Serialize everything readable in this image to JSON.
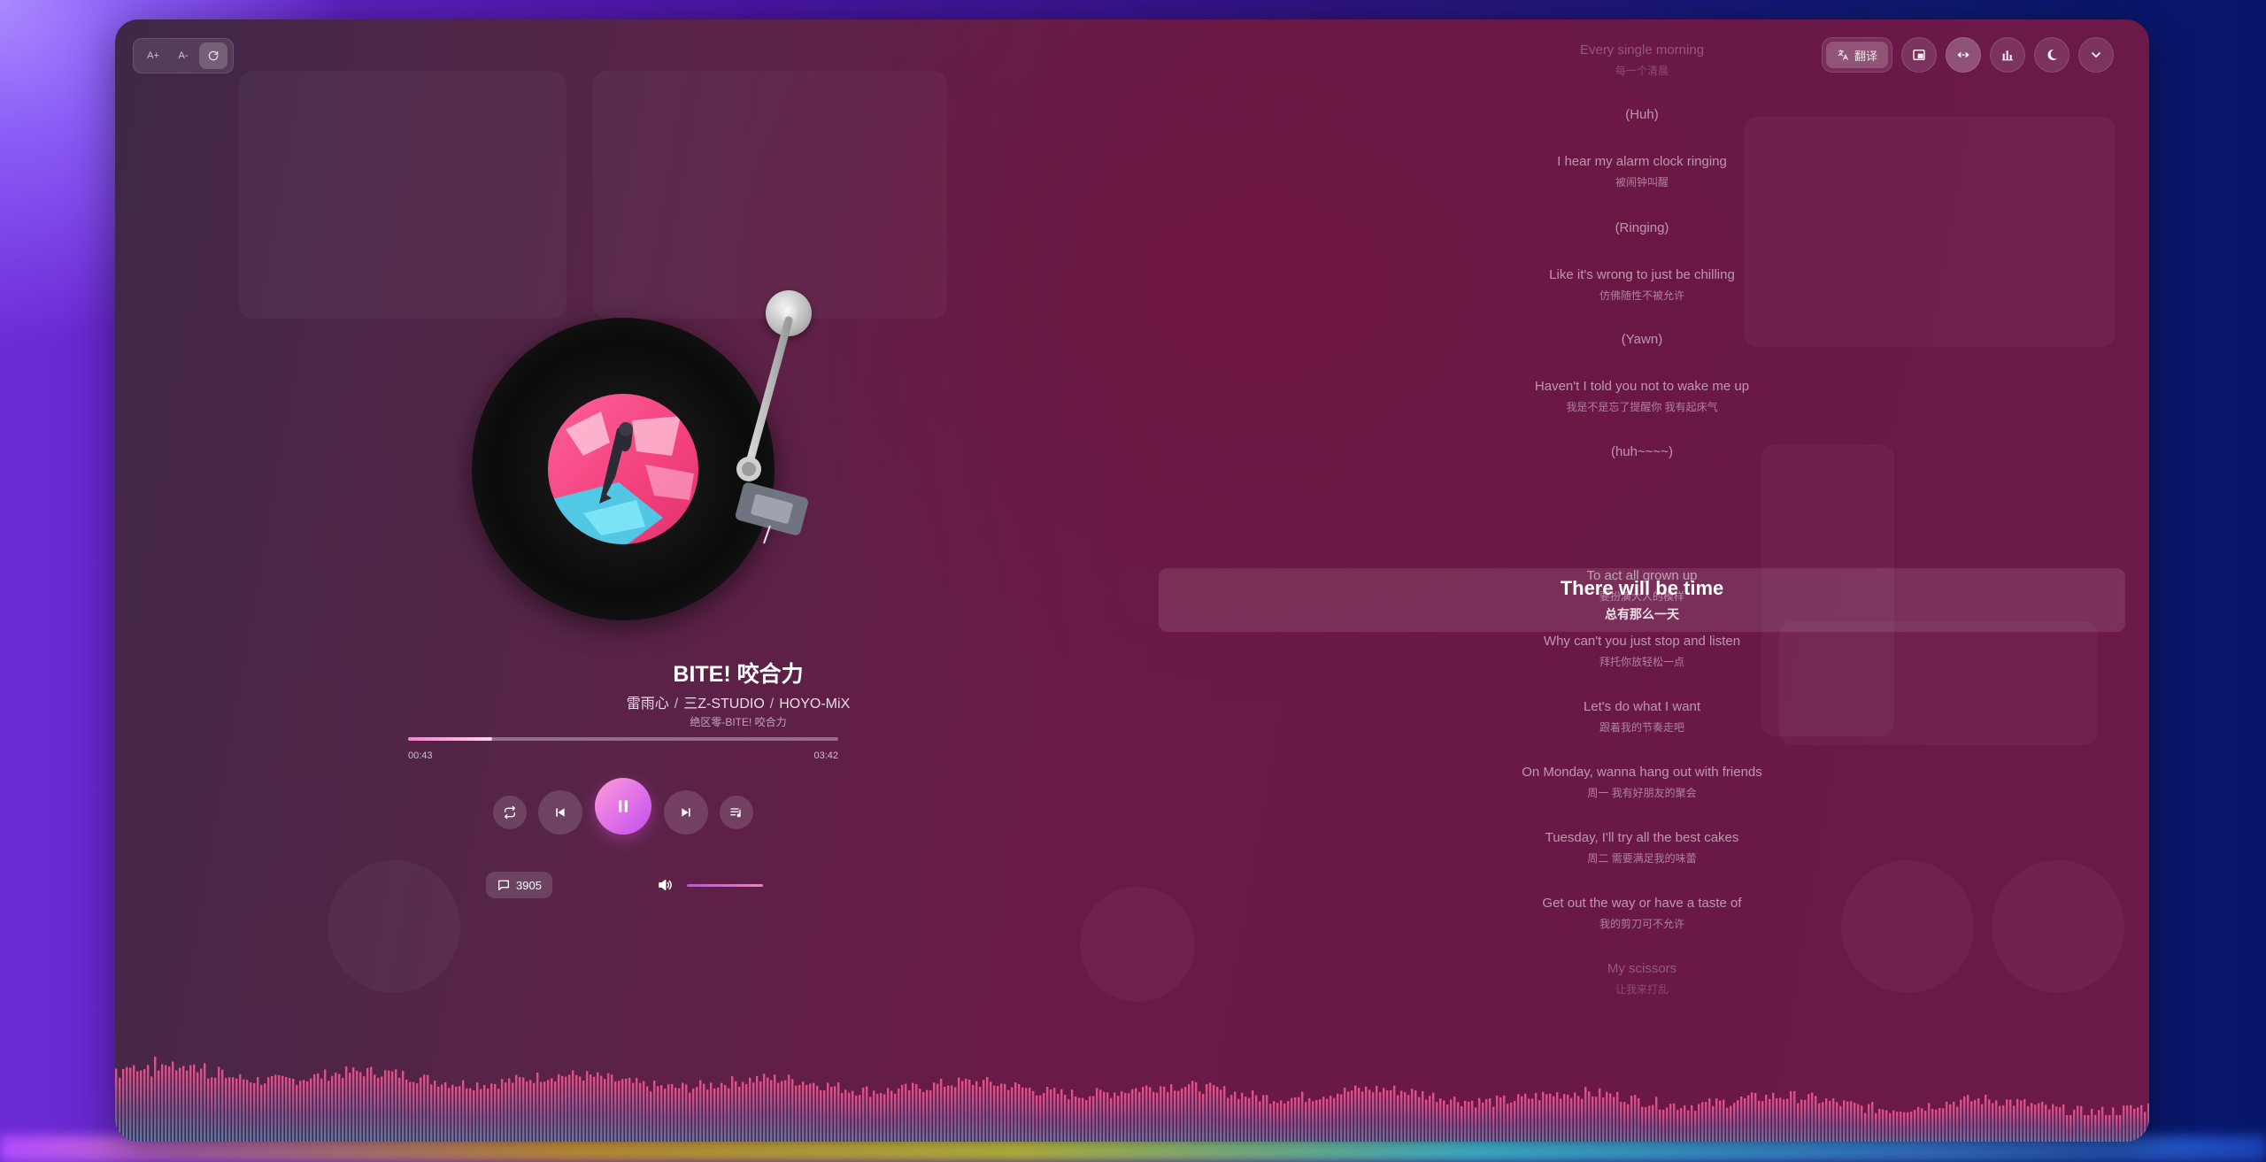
{
  "app": {
    "font_controls": [
      {
        "label": "A+",
        "icon": "font-increase-icon"
      },
      {
        "label": "A-",
        "icon": "font-decrease-icon"
      },
      {
        "icon": "reset-font-icon",
        "active": true
      }
    ],
    "top_right": {
      "translate_label": "翻译",
      "buttons": [
        "picture-in-picture-icon",
        "shrink-icon",
        "spectrum-icon",
        "dark-mode-icon",
        "collapse-chevron-icon"
      ]
    }
  },
  "track": {
    "title": "BITE! 咬合力",
    "artists": [
      "雷雨心",
      "三Z-STUDIO",
      "HOYO-MiX"
    ],
    "album": "绝区零-BITE! 咬合力",
    "current_time": "00:43",
    "duration": "03:42",
    "progress": 0.195
  },
  "controls": {
    "repeat_icon": "repeat-icon",
    "prev_icon": "skip-previous-icon",
    "play_icon": "pause-icon",
    "next_icon": "skip-next-icon",
    "playlist_icon": "playlist-icon",
    "comment_count": "3905",
    "volume_icon": "volume-icon",
    "volume_level": 1.0
  },
  "lyrics": [
    {
      "en": "Every single morning",
      "cn": "每一个清晨",
      "dim": true
    },
    {
      "en": "(Huh)",
      "cn": ""
    },
    {
      "en": "I hear my alarm clock ringing",
      "cn": "被闹钟叫醒"
    },
    {
      "en": "(Ringing)",
      "cn": ""
    },
    {
      "en": "Like it's wrong to just be chilling",
      "cn": "仿佛随性不被允许"
    },
    {
      "en": "(Yawn)",
      "cn": ""
    },
    {
      "en": "Haven't I told you not to wake me up",
      "cn": "我是不是忘了提醒你 我有起床气"
    },
    {
      "en": "(huh~~~~)",
      "cn": ""
    },
    {
      "en": "There will be time",
      "cn": "总有那么一天",
      "active": true
    },
    {
      "en": "To act all grown up",
      "cn": "要扮演大人的模样"
    },
    {
      "en": "Why can't you just stop and listen",
      "cn": "拜托你放轻松一点"
    },
    {
      "en": "Let's do what I want",
      "cn": "跟着我的节奏走吧"
    },
    {
      "en": "On Monday, wanna hang out with friends",
      "cn": "周一 我有好朋友的聚会"
    },
    {
      "en": "Tuesday, I'll try all the best cakes",
      "cn": "周二 需要满足我的味蕾"
    },
    {
      "en": "Get out the way or have a taste of",
      "cn": "我的剪刀可不允许"
    },
    {
      "en": "My scissors",
      "cn": "让我来打乱",
      "dim": true
    }
  ]
}
